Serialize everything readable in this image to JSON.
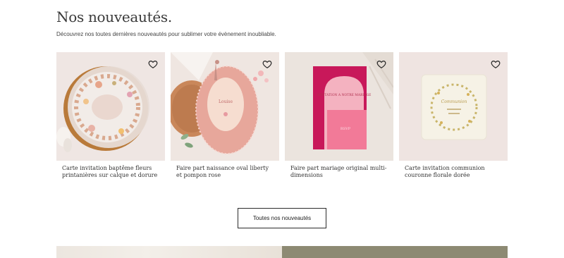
{
  "section": {
    "title": "Nos nouveautés.",
    "subtitle": "Découvrez nos toutes dernières nouveautés pour sublimer votre évènement inoubliable."
  },
  "products": [
    {
      "name": "Carte invitation baptême fleurs printanières sur calque et dorure",
      "favorite_icon": "heart-outline-icon"
    },
    {
      "name": "Faire part naissance oval liberty et pompon rose",
      "card_text": "Louise",
      "favorite_icon": "heart-outline-icon"
    },
    {
      "name": "Faire part mariage original multi-dimensions",
      "card_text": "INVITATION A NOTRE MARIAGE",
      "card_text_2": "RSVP",
      "favorite_icon": "heart-outline-icon"
    },
    {
      "name": "Carte invitation communion couronne florale dorée",
      "card_text": "Communion",
      "favorite_icon": "heart-outline-icon"
    }
  ],
  "cta": {
    "label": "Toutes nos nouveautés"
  },
  "colors": {
    "accent_pink": "#d6256b",
    "banner_olive": "#8d8a73",
    "thumb_bg": "#efe6e2"
  }
}
